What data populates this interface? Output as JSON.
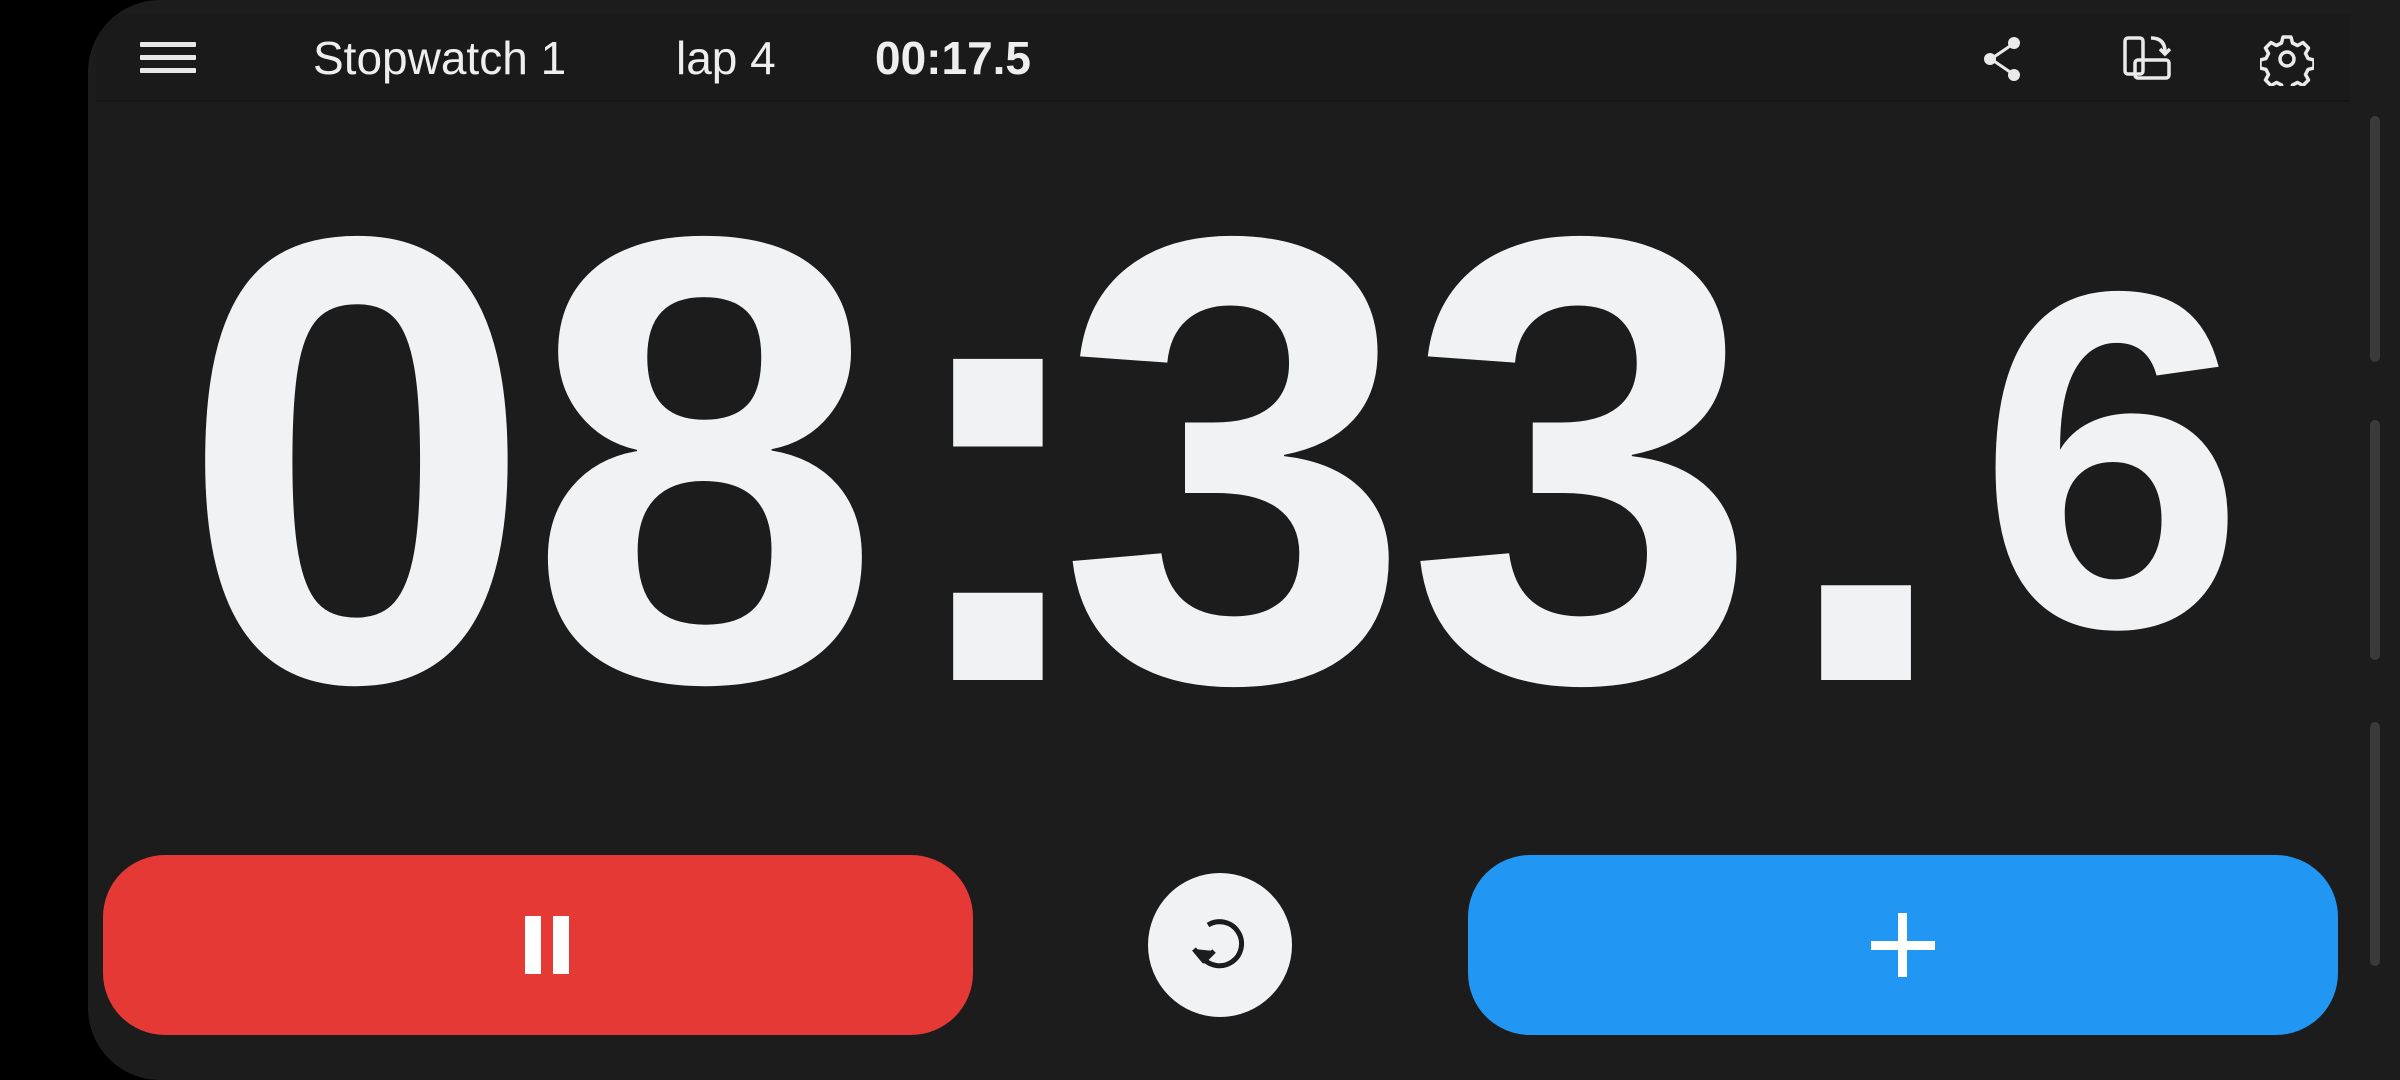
{
  "toolbar": {
    "stopwatch_name": "Stopwatch 1",
    "lap_label": "lap 4",
    "lap_time": "00:17.5",
    "icons": [
      "menu-icon",
      "share-icon",
      "rotate-screen-icon",
      "gear-icon"
    ]
  },
  "display": {
    "minutes": "08",
    "separator": ":",
    "seconds": "33",
    "decimal": ".",
    "tenths": "6"
  },
  "controls": {
    "pause_icon": "pause-icon",
    "reset_icon": "reset-icon",
    "lap_icon": "plus-icon"
  },
  "colors": {
    "background": "#1c1c1c",
    "pause": "#e53935",
    "add_lap": "#2196f3",
    "text": "#f1f2f4"
  }
}
